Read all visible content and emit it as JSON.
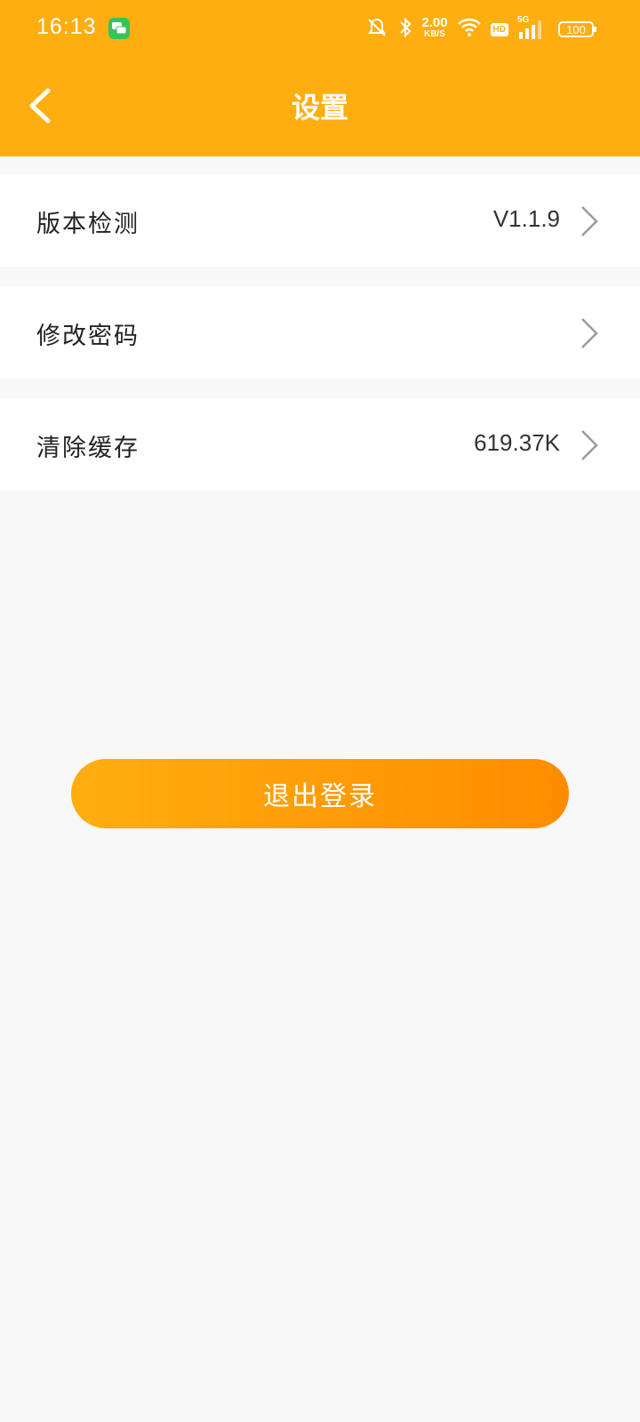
{
  "status_bar": {
    "time": "16:13",
    "net_speed_value": "2.00",
    "net_speed_unit": "KB/S",
    "hd": "HD",
    "signal": "5G",
    "battery": "100"
  },
  "header": {
    "title": "设置"
  },
  "settings": {
    "items": [
      {
        "label": "版本检测",
        "value": "V1.1.9"
      },
      {
        "label": "修改密码",
        "value": ""
      },
      {
        "label": "清除缓存",
        "value": "619.37K"
      }
    ]
  },
  "actions": {
    "logout_label": "退出登录"
  },
  "colors": {
    "primary": "#ffae10",
    "primary_dark": "#ff8c00",
    "background": "#f8f8f8"
  }
}
